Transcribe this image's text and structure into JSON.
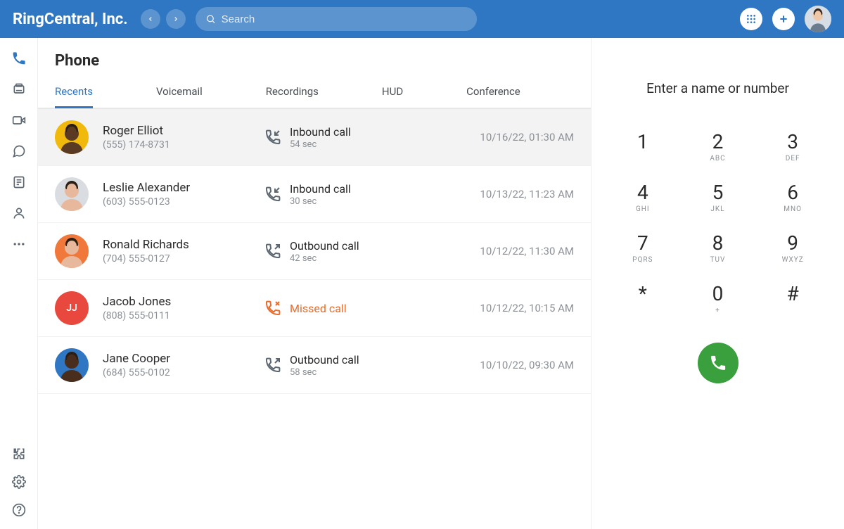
{
  "header": {
    "brand": "RingCentral, Inc.",
    "search_placeholder": "Search"
  },
  "page": {
    "title": "Phone"
  },
  "tabs": [
    {
      "id": "recents",
      "label": "Recents",
      "active": true
    },
    {
      "id": "voicemail",
      "label": "Voicemail",
      "active": false
    },
    {
      "id": "recordings",
      "label": "Recordings",
      "active": false
    },
    {
      "id": "hud",
      "label": "HUD",
      "active": false
    },
    {
      "id": "conference",
      "label": "Conference",
      "active": false
    }
  ],
  "calls": [
    {
      "name": "Roger Elliot",
      "number": "(555) 174-8731",
      "type": "Inbound call",
      "type_id": "inbound",
      "duration": "54 sec",
      "timestamp": "10/16/22, 01:30 AM",
      "avatar_bg": "#f1b90c",
      "avatar_initials": "",
      "avatar_skin": "#5b3a24",
      "highlight": true
    },
    {
      "name": "Leslie Alexander",
      "number": "(603) 555-0123",
      "type": "Inbound call",
      "type_id": "inbound",
      "duration": "30 sec",
      "timestamp": "10/13/22, 11:23 AM",
      "avatar_bg": "#d9dde2",
      "avatar_initials": "",
      "avatar_skin": "#e8b89c",
      "highlight": false
    },
    {
      "name": "Ronald Richards",
      "number": "(704) 555-0127",
      "type": "Outbound call",
      "type_id": "outbound",
      "duration": "42 sec",
      "timestamp": "10/12/22, 11:30 AM",
      "avatar_bg": "#f0783a",
      "avatar_initials": "",
      "avatar_skin": "#e8b89c",
      "highlight": false
    },
    {
      "name": "Jacob Jones",
      "number": "(808) 555-0111",
      "type": "Missed call",
      "type_id": "missed",
      "duration": "",
      "timestamp": "10/12/22, 10:15 AM",
      "avatar_bg": "#e8483d",
      "avatar_initials": "JJ",
      "avatar_skin": "",
      "highlight": false
    },
    {
      "name": "Jane Cooper",
      "number": "(684) 555-0102",
      "type": "Outbound call",
      "type_id": "outbound",
      "duration": "58 sec",
      "timestamp": "10/10/22, 09:30 AM",
      "avatar_bg": "#2f77c2",
      "avatar_initials": "",
      "avatar_skin": "#4a2e1d",
      "highlight": false
    }
  ],
  "dialer": {
    "prompt": "Enter a name or number",
    "keys": [
      {
        "digit": "1",
        "letters": ""
      },
      {
        "digit": "2",
        "letters": "ABC"
      },
      {
        "digit": "3",
        "letters": "DEF"
      },
      {
        "digit": "4",
        "letters": "GHI"
      },
      {
        "digit": "5",
        "letters": "JKL"
      },
      {
        "digit": "6",
        "letters": "MNO"
      },
      {
        "digit": "7",
        "letters": "PQRS"
      },
      {
        "digit": "8",
        "letters": "TUV"
      },
      {
        "digit": "9",
        "letters": "WXYZ"
      },
      {
        "digit": "*",
        "letters": ""
      },
      {
        "digit": "0",
        "letters": "+"
      },
      {
        "digit": "#",
        "letters": ""
      }
    ]
  }
}
